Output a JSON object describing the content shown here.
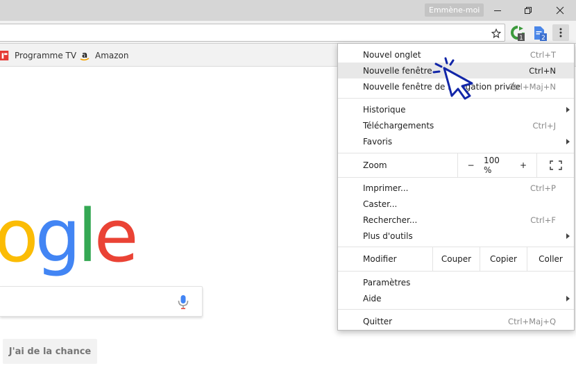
{
  "window": {
    "profile_label": "Emmène-moi"
  },
  "bookmarks": [
    {
      "label": "Programme TV",
      "icon": "tf1-icon"
    },
    {
      "label": "Amazon",
      "icon": "amazon-icon"
    }
  ],
  "extensions": [
    {
      "icon": "green-extension-icon",
      "badge": "1"
    },
    {
      "icon": "docs-extension-icon",
      "badge": "2"
    }
  ],
  "page": {
    "logo_letters": [
      {
        "char": "o",
        "color": "#FBBC05"
      },
      {
        "char": "g",
        "color": "#4285F4"
      },
      {
        "char": "l",
        "color": "#34A853"
      },
      {
        "char": "e",
        "color": "#EA4335"
      }
    ],
    "lucky_button": "J'ai de la chance",
    "mic_color": "#4285F4"
  },
  "menu": {
    "new_tab": {
      "label": "Nouvel onglet",
      "shortcut": "Ctrl+T"
    },
    "new_window": {
      "label": "Nouvelle fenêtre",
      "shortcut": "Ctrl+N"
    },
    "incognito": {
      "label": "Nouvelle fenêtre de navigation privée",
      "shortcut": "Ctrl+Maj+N"
    },
    "history": {
      "label": "Historique"
    },
    "downloads": {
      "label": "Téléchargements",
      "shortcut": "Ctrl+J"
    },
    "bookmarks": {
      "label": "Favoris"
    },
    "zoom": {
      "label": "Zoom",
      "minus": "−",
      "level": "100 %",
      "plus": "+"
    },
    "print": {
      "label": "Imprimer...",
      "shortcut": "Ctrl+P"
    },
    "cast": {
      "label": "Caster..."
    },
    "find": {
      "label": "Rechercher...",
      "shortcut": "Ctrl+F"
    },
    "more_tools": {
      "label": "Plus d'outils"
    },
    "edit": {
      "label": "Modifier",
      "cut": "Couper",
      "copy": "Copier",
      "paste": "Coller"
    },
    "settings": {
      "label": "Paramètres"
    },
    "help": {
      "label": "Aide"
    },
    "quit": {
      "label": "Quitter",
      "shortcut": "Ctrl+Maj+Q"
    }
  },
  "colors": {
    "cursor": "#1226a8"
  }
}
